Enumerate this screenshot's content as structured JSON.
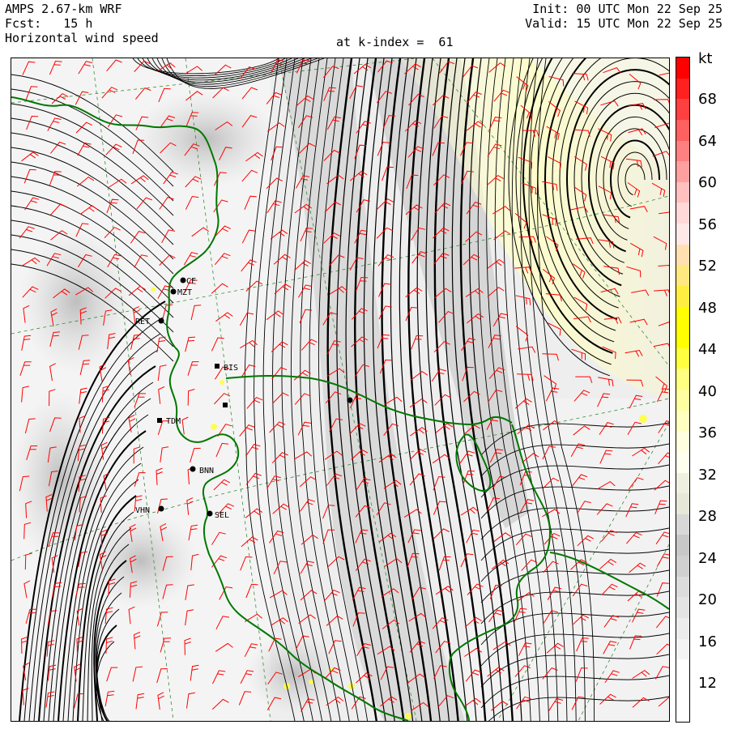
{
  "header": {
    "model": "AMPS 2.67-km WRF",
    "forecast": "Fcst:   15 h",
    "field": "Horizontal wind speed",
    "init": "Init: 00 UTC Mon 22 Sep 25",
    "valid": "Valid: 15 UTC Mon 22 Sep 25",
    "level": "at k-index =  61"
  },
  "colorbar": {
    "unit": "kt",
    "labels": [
      "68",
      "64",
      "60",
      "56",
      "52",
      "48",
      "44",
      "40",
      "36",
      "32",
      "28",
      "24",
      "20",
      "16",
      "12"
    ],
    "colors": [
      "#ff0000",
      "#ff2020",
      "#ff4040",
      "#ff6060",
      "#ff8080",
      "#ffa0a0",
      "#ffc0c0",
      "#ffd8d8",
      "#ffe8e8",
      "#ffe0b0",
      "#ffe880",
      "#ffee40",
      "#ffff00",
      "#ffff00",
      "#ffff40",
      "#ffff80",
      "#ffffa0",
      "#ffffc0",
      "#ffffe0",
      "#fffff0",
      "#f0f0e0",
      "#e8e8d8",
      "#d8d8d8",
      "#c8c8c8",
      "#d0d0d0",
      "#dcdcdc",
      "#e4e4e4",
      "#ececec",
      "#f4f4f4",
      "#ffffff",
      "#ffffff",
      "#ffffff"
    ]
  },
  "stations": [
    {
      "id": "MZT",
      "label": "MZT"
    },
    {
      "id": "RET",
      "label": "RET"
    },
    {
      "id": "BIS",
      "label": "BIS"
    },
    {
      "id": "TDM",
      "label": "TDM"
    },
    {
      "id": "BNN",
      "label": "BNN"
    },
    {
      "id": "VHN",
      "label": "VHN"
    },
    {
      "id": "SEL",
      "label": "SEL"
    },
    {
      "id": "CF",
      "label": "CF"
    }
  ]
}
